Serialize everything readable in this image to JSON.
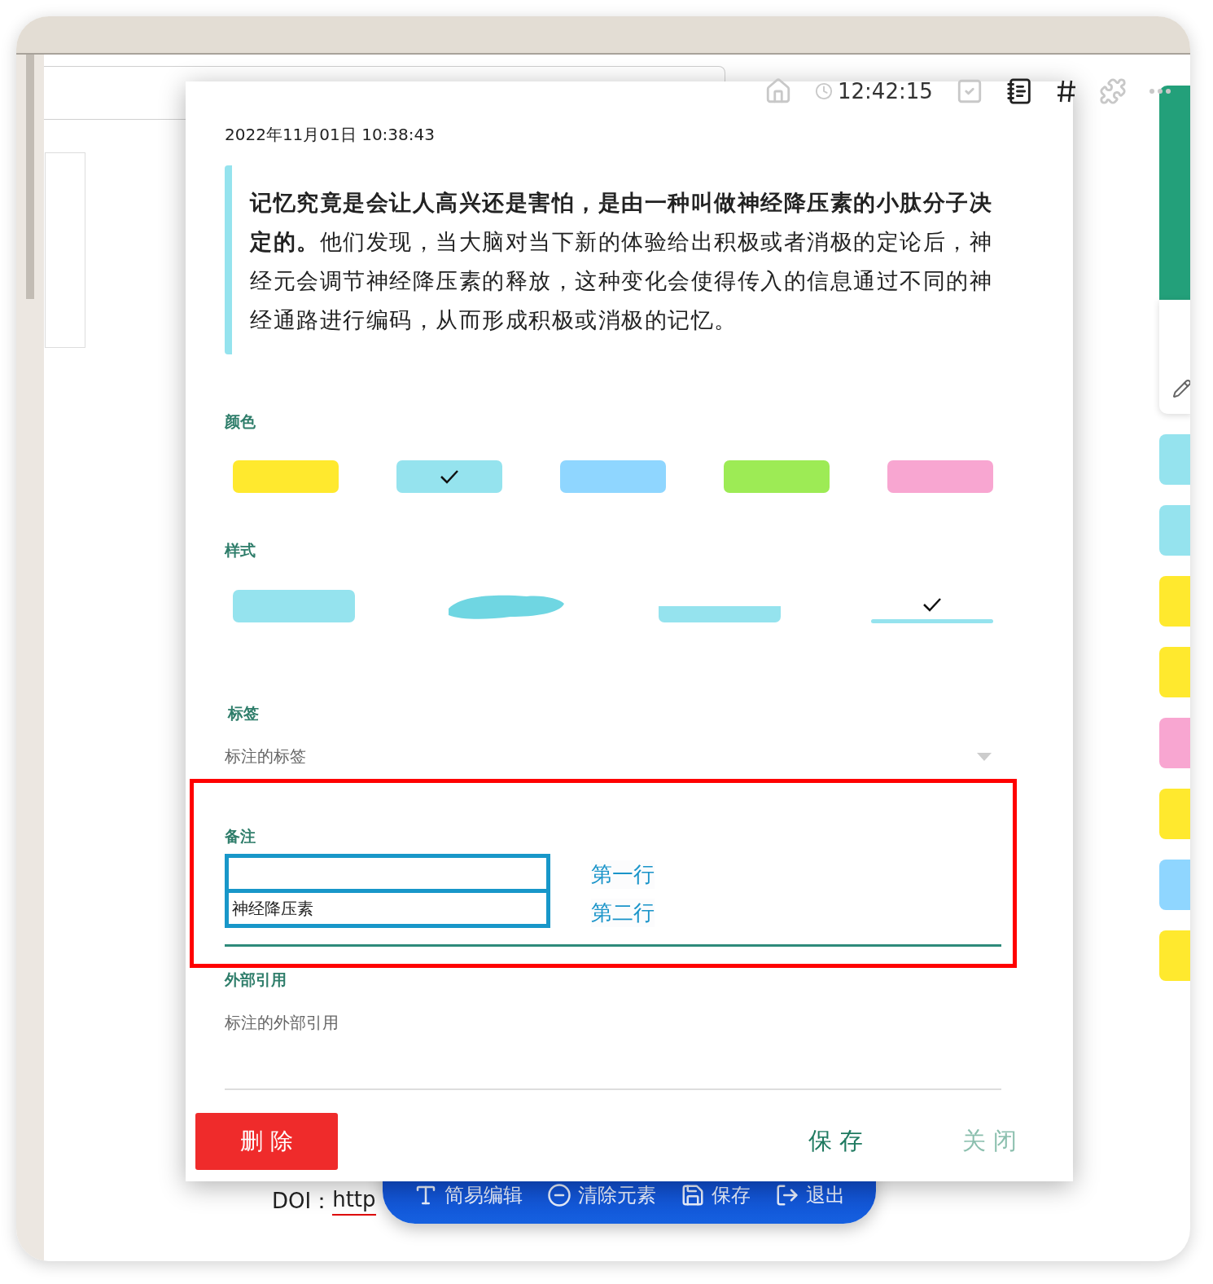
{
  "toolbar": {
    "time": "12:42:15"
  },
  "dialog": {
    "timestamp": "2022年11月01日 10:38:43",
    "quote": "**记忆究竟是会让人高兴还是害怕，是由一种叫做神经降压素的小肽分子决定的。**他们发现，当大脑对当下新的体验给出积极或者消极的定论后，神经元会调节神经降压素的释放，这种变化会使得传入的信息通过不同的神经通路进行编码，从而形成积极或消极的记忆。",
    "color_label": "颜色",
    "colors": [
      {
        "color": "#ffe92e",
        "selected": false
      },
      {
        "color": "#95e3ee",
        "selected": true
      },
      {
        "color": "#8fd6ff",
        "selected": false
      },
      {
        "color": "#9deb55",
        "selected": false
      },
      {
        "color": "#f8a6d1",
        "selected": false
      }
    ],
    "style_label": "样式",
    "styles": [
      {
        "kind": "block",
        "selected": false
      },
      {
        "kind": "brush",
        "selected": false
      },
      {
        "kind": "half",
        "selected": false
      },
      {
        "kind": "underline",
        "selected": true
      }
    ],
    "tags": {
      "label": "标签",
      "placeholder": "标注的标签"
    },
    "note": {
      "label": "备注",
      "lines": [
        {
          "hint": "第一行"
        },
        {
          "value": "神经降压素",
          "hint": "第二行"
        }
      ]
    },
    "reference": {
      "label": "外部引用",
      "placeholder": "标注的外部引用"
    },
    "buttons": {
      "delete": "删 除",
      "save": "保 存",
      "close": "关 闭"
    }
  },
  "doi": {
    "label": "DOI：",
    "link": "http"
  },
  "float_bar": [
    {
      "kind": "text",
      "label": "简易编辑"
    },
    {
      "kind": "clear",
      "label": "清除元素"
    },
    {
      "kind": "save",
      "label": "保存"
    },
    {
      "kind": "exit",
      "label": "退出"
    }
  ],
  "side_cards": [
    {
      "color": "#95e3ee"
    },
    {
      "color": "#95e3ee"
    },
    {
      "color": "#ffe92e"
    },
    {
      "color": "#ffe92e"
    },
    {
      "color": "#f8a6d1"
    },
    {
      "color": "#ffe92e"
    },
    {
      "color": "#8fd6ff"
    },
    {
      "color": "#ffe92e"
    }
  ]
}
